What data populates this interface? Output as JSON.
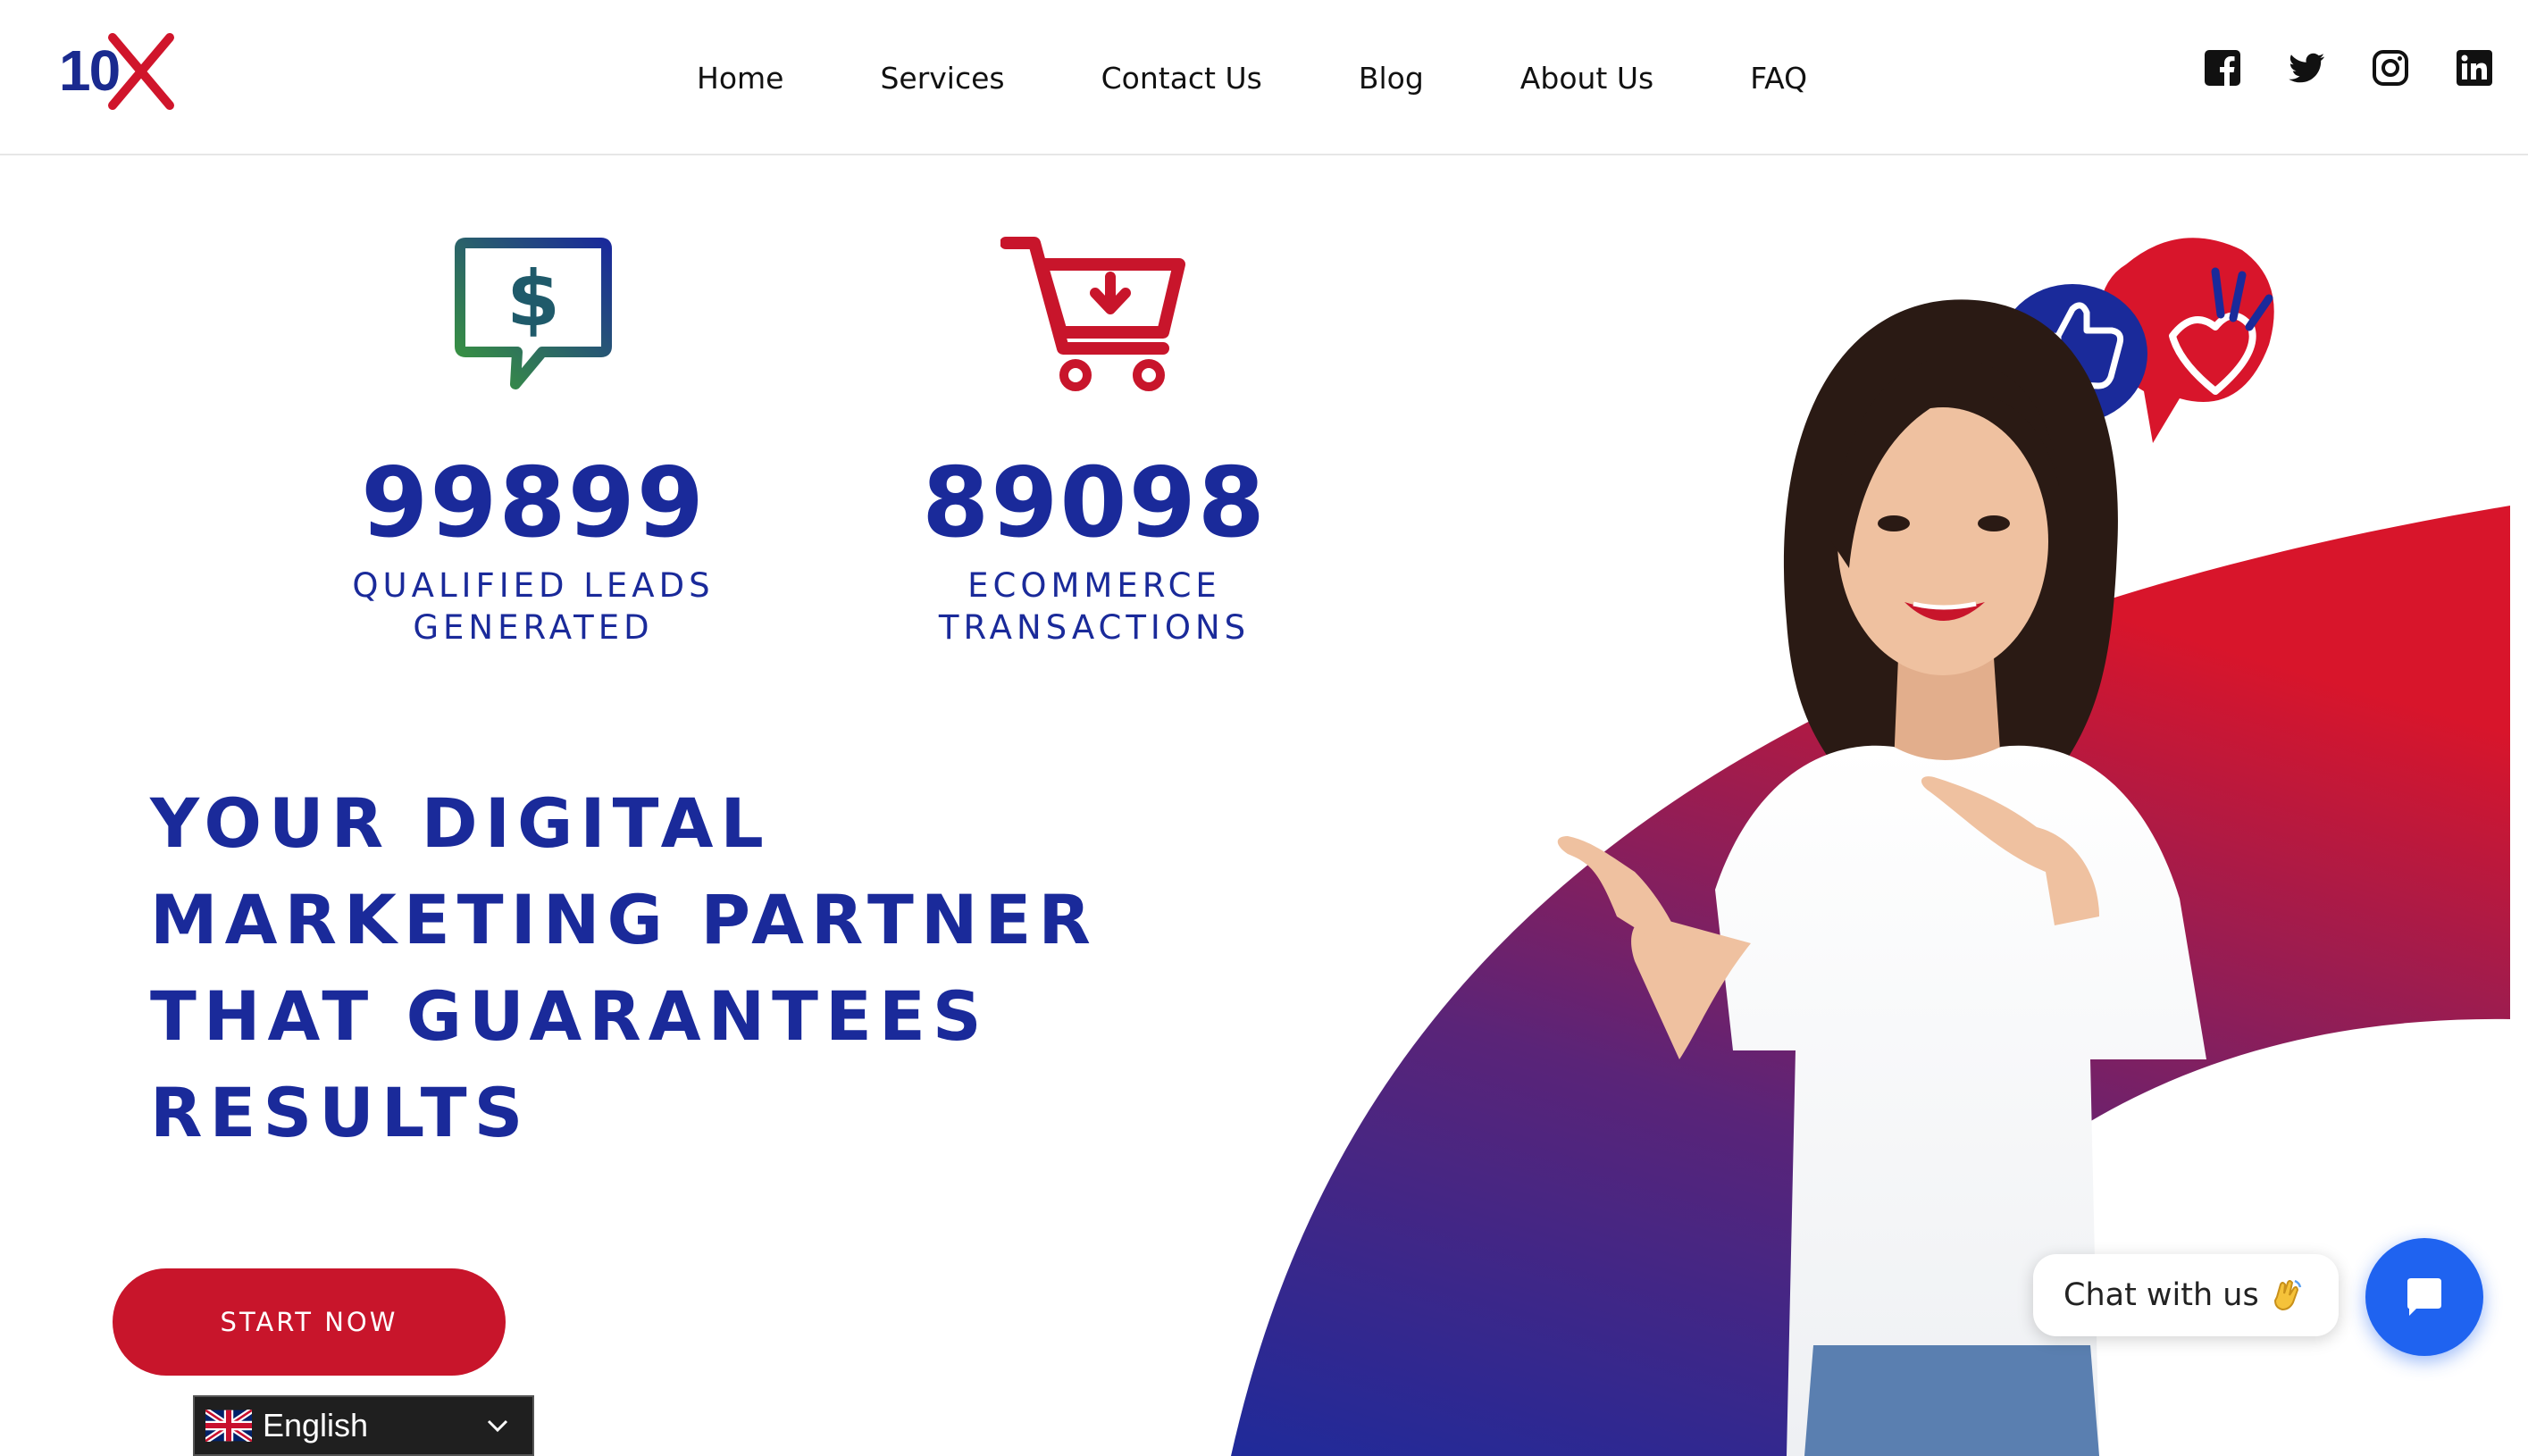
{
  "brand": {
    "logo_text": "10",
    "primary_color": "#1a2a9a",
    "accent_color": "#c8152b"
  },
  "nav": {
    "items": [
      {
        "label": "Home"
      },
      {
        "label": "Services"
      },
      {
        "label": "Contact Us"
      },
      {
        "label": "Blog"
      },
      {
        "label": "About Us"
      },
      {
        "label": "FAQ"
      }
    ]
  },
  "social": [
    {
      "icon": "facebook-icon"
    },
    {
      "icon": "twitter-icon"
    },
    {
      "icon": "instagram-icon"
    },
    {
      "icon": "linkedin-icon"
    }
  ],
  "stats": [
    {
      "icon": "dollar-chat-icon",
      "number": "99899",
      "label_line1": "QUALIFIED LEADS",
      "label_line2": "GENERATED"
    },
    {
      "icon": "shopping-cart-icon",
      "number": "89098",
      "label_line1": "ECOMMERCE",
      "label_line2": "TRANSACTIONS"
    }
  ],
  "headline": {
    "lines": [
      "YOUR DIGITAL",
      "MARKETING PARTNER",
      "THAT GUARANTEES",
      "RESULTS"
    ]
  },
  "cta": {
    "label": "START NOW"
  },
  "language": {
    "selected": "English"
  },
  "chat": {
    "bubble_text": "Chat with us",
    "button_color": "#1f63f0"
  }
}
